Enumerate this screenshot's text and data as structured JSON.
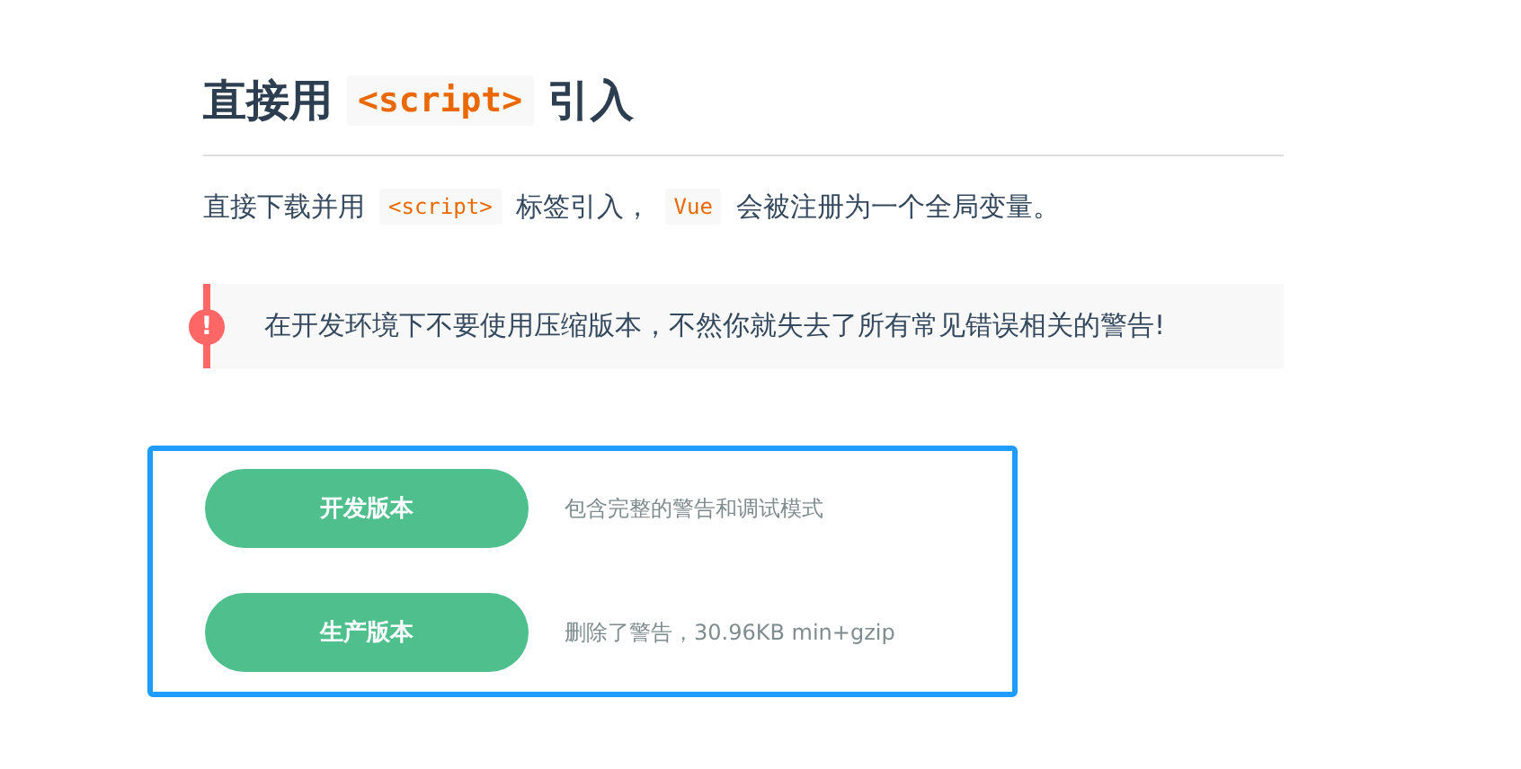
{
  "heading": [
    {
      "kind": "text",
      "text": "直接用"
    },
    {
      "kind": "code",
      "text": "<script>"
    },
    {
      "kind": "text",
      "text": "引入"
    }
  ],
  "paragraph": [
    {
      "kind": "text",
      "text": "直接下载并用"
    },
    {
      "kind": "code",
      "text": "<script>"
    },
    {
      "kind": "text",
      "text": "标签引入，"
    },
    {
      "kind": "code",
      "text": "Vue"
    },
    {
      "kind": "text",
      "text": "会被注册为一个全局变量。"
    }
  ],
  "warning": {
    "icon": "!",
    "text": "在开发环境下不要使用压缩版本，不然你就失去了所有常见错误相关的警告!"
  },
  "downloads": [
    {
      "button": "开发版本",
      "description": "包含完整的警告和调试模式"
    },
    {
      "button": "生产版本",
      "description": "删除了警告，30.96KB min+gzip"
    }
  ]
}
